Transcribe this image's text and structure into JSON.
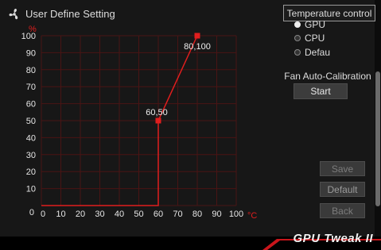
{
  "window": {
    "title": "User Define Setting"
  },
  "chart_data": {
    "type": "line",
    "x_unit": "°C",
    "y_unit": "%",
    "x_ticks": [
      "0",
      "10",
      "20",
      "30",
      "40",
      "50",
      "60",
      "70",
      "80",
      "90",
      "100"
    ],
    "y_ticks": [
      "10",
      "20",
      "30",
      "40",
      "50",
      "60",
      "70",
      "80",
      "90",
      "100"
    ],
    "y_zero_label": "0",
    "xlim": [
      0,
      100
    ],
    "ylim": [
      0,
      100
    ],
    "grid": true,
    "series": [
      {
        "points": [
          [
            0,
            0
          ],
          [
            60,
            0
          ],
          [
            60,
            50
          ],
          [
            80,
            100
          ]
        ]
      }
    ],
    "control_points": [
      {
        "x": 60,
        "y": 50,
        "label": "60,50"
      },
      {
        "x": 80,
        "y": 100,
        "label": "80,100"
      }
    ],
    "colors": {
      "line": "#e01e1e",
      "grid": "#4a1414"
    }
  },
  "temperature_control": {
    "label": "Temperature control",
    "options": [
      {
        "label": "GPU",
        "selected": true
      },
      {
        "label": "CPU",
        "selected": false
      },
      {
        "label": "Defau",
        "selected": false
      }
    ]
  },
  "calibration": {
    "label": "Fan Auto-Calibration",
    "button": "Start"
  },
  "buttons": {
    "save": "Save",
    "default": "Default",
    "back": "Back"
  },
  "brand": {
    "text": "GPU Tweak II"
  }
}
